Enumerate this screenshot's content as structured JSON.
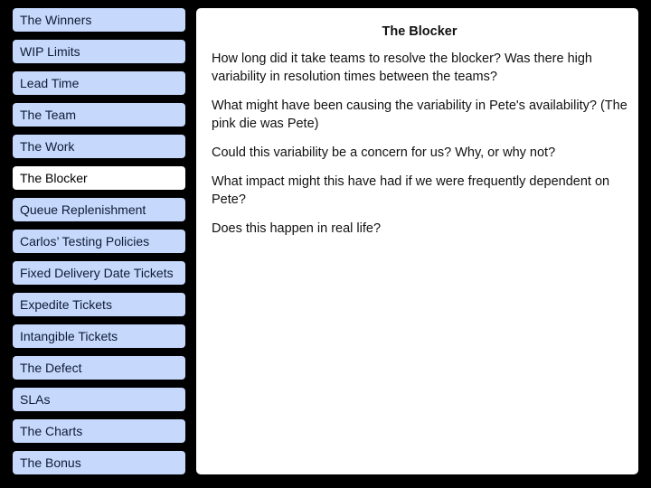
{
  "colors": {
    "background": "#000000",
    "nav_item_bg": "#c6d9fd",
    "nav_item_active_bg": "#ffffff",
    "panel_bg": "#ffffff"
  },
  "nav": {
    "active_index": 5,
    "items": [
      {
        "label": "The Winners"
      },
      {
        "label": "WIP Limits"
      },
      {
        "label": "Lead Time"
      },
      {
        "label": "The Team"
      },
      {
        "label": "The Work"
      },
      {
        "label": "The Blocker"
      },
      {
        "label": "Queue Replenishment"
      },
      {
        "label": "Carlos’ Testing Policies"
      },
      {
        "label": "Fixed Delivery Date Tickets"
      },
      {
        "label": "Expedite Tickets"
      },
      {
        "label": "Intangible Tickets"
      },
      {
        "label": "The Defect"
      },
      {
        "label": "SLAs"
      },
      {
        "label": "The Charts"
      },
      {
        "label": "The Bonus"
      }
    ]
  },
  "panel": {
    "title": "The Blocker",
    "paragraphs": [
      "How long did it take teams to resolve the blocker? Was there high variability in resolution times between the teams?",
      "What might have been causing the variability in Pete's availability? (The pink die was Pete)",
      "Could this variability be a concern for us? Why, or why not?",
      "What impact might this have had if we were frequently dependent on Pete?",
      "Does this happen in real life?"
    ]
  }
}
